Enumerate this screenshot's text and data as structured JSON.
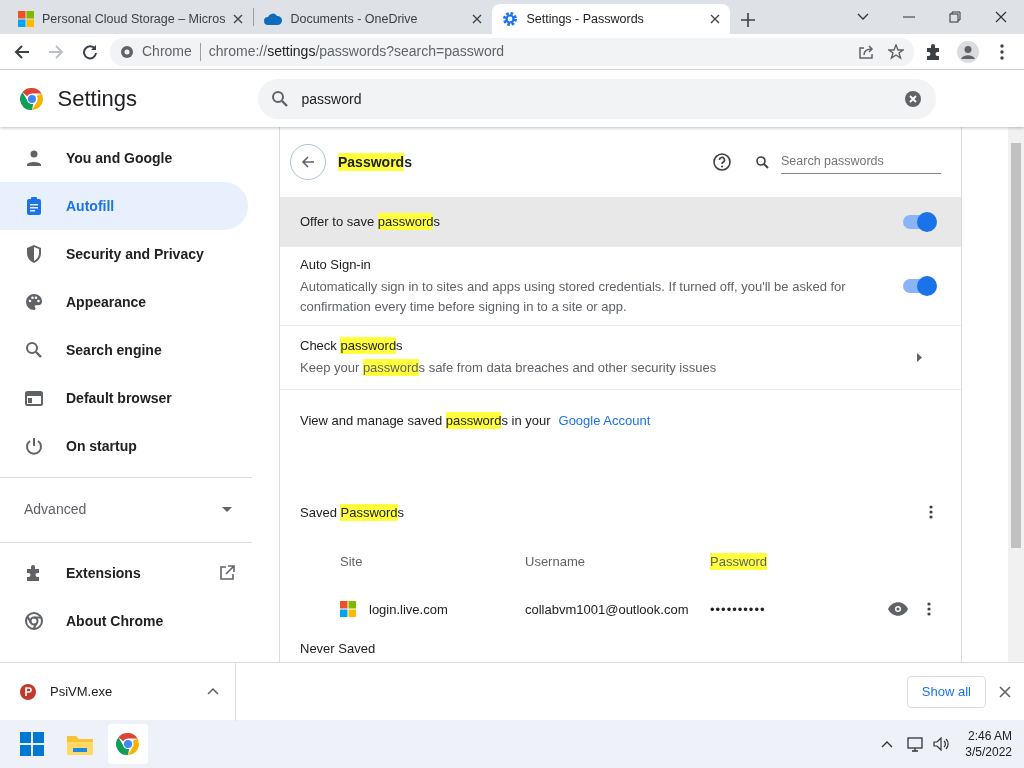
{
  "tabs": [
    {
      "title": "Personal Cloud Storage – Micros",
      "selected": false
    },
    {
      "title": "Documents - OneDrive",
      "selected": false
    },
    {
      "title": "Settings - Passwords",
      "selected": true
    }
  ],
  "address_bar": {
    "chip": "Chrome",
    "url_prefix": "chrome://",
    "url_host": "settings",
    "url_path": "/passwords?search=password"
  },
  "header": {
    "title": "Settings",
    "search_value": "password"
  },
  "sidebar": {
    "items": [
      {
        "label": "You and Google",
        "selected": false
      },
      {
        "label": "Autofill",
        "selected": true
      },
      {
        "label": "Security and Privacy",
        "selected": false
      },
      {
        "label": "Appearance",
        "selected": false
      },
      {
        "label": "Search engine",
        "selected": false
      },
      {
        "label": "Default browser",
        "selected": false
      },
      {
        "label": "On startup",
        "selected": false
      }
    ],
    "advanced": "Advanced",
    "bottom_items": [
      {
        "label": "Extensions"
      },
      {
        "label": "About Chrome"
      }
    ]
  },
  "page": {
    "title": [
      {
        "text": "Password",
        "highlight": true
      },
      {
        "text": "s",
        "highlight": false
      }
    ],
    "search_placeholder": "Search passwords",
    "settings": [
      {
        "kind": "toggle",
        "hovered": true,
        "on": true,
        "title": [
          {
            "text": "Offer to save ",
            "highlight": false
          },
          {
            "text": "password",
            "highlight": true
          },
          {
            "text": "s",
            "highlight": false
          }
        ]
      },
      {
        "kind": "toggle",
        "hovered": false,
        "on": true,
        "title": [
          {
            "text": "Auto Sign-in",
            "highlight": false
          }
        ],
        "description": [
          {
            "text": "Automatically sign in to sites and apps using stored credentials. If turned off, you'll be asked for confirmation every time before signing in to a site or app.",
            "highlight": false
          }
        ]
      },
      {
        "kind": "link",
        "hovered": false,
        "title": [
          {
            "text": "Check ",
            "highlight": false
          },
          {
            "text": "password",
            "highlight": true
          },
          {
            "text": "s",
            "highlight": false
          }
        ],
        "description": [
          {
            "text": "Keep your ",
            "highlight": false
          },
          {
            "text": "password",
            "highlight": true
          },
          {
            "text": "s safe from data breaches and other security issues",
            "highlight": false
          }
        ]
      }
    ],
    "manage_text": [
      {
        "text": "View and manage saved ",
        "highlight": false
      },
      {
        "text": "password",
        "highlight": true
      },
      {
        "text": "s in your",
        "highlight": false
      }
    ],
    "manage_link": "Google Account",
    "saved_title": [
      {
        "text": "Saved ",
        "highlight": false
      },
      {
        "text": "Password",
        "highlight": true
      },
      {
        "text": "s",
        "highlight": false
      }
    ],
    "columns": [
      [
        {
          "text": "Site",
          "highlight": false
        }
      ],
      [
        {
          "text": "Username",
          "highlight": false
        }
      ],
      [
        {
          "text": "Password",
          "highlight": true
        }
      ]
    ],
    "rows": [
      {
        "site": "login.live.com",
        "username": "collabvm1001@outlook.com",
        "password": "••••••••••"
      }
    ],
    "never_saved": "Never Saved"
  },
  "download_bar": {
    "file": "PsiVM.exe",
    "show_all": "Show all"
  },
  "taskbar": {
    "time": "2:46 AM",
    "date": "3/5/2022"
  }
}
